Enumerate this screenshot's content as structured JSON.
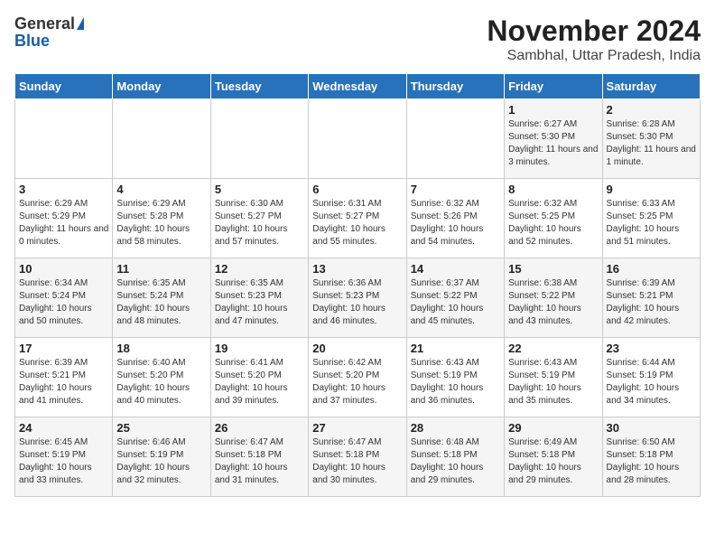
{
  "header": {
    "logo_general": "General",
    "logo_blue": "Blue",
    "title": "November 2024",
    "subtitle": "Sambhal, Uttar Pradesh, India"
  },
  "days_of_week": [
    "Sunday",
    "Monday",
    "Tuesday",
    "Wednesday",
    "Thursday",
    "Friday",
    "Saturday"
  ],
  "weeks": [
    [
      {
        "day": "",
        "info": ""
      },
      {
        "day": "",
        "info": ""
      },
      {
        "day": "",
        "info": ""
      },
      {
        "day": "",
        "info": ""
      },
      {
        "day": "",
        "info": ""
      },
      {
        "day": "1",
        "info": "Sunrise: 6:27 AM\nSunset: 5:30 PM\nDaylight: 11 hours and 3 minutes."
      },
      {
        "day": "2",
        "info": "Sunrise: 6:28 AM\nSunset: 5:30 PM\nDaylight: 11 hours and 1 minute."
      }
    ],
    [
      {
        "day": "3",
        "info": "Sunrise: 6:29 AM\nSunset: 5:29 PM\nDaylight: 11 hours and 0 minutes."
      },
      {
        "day": "4",
        "info": "Sunrise: 6:29 AM\nSunset: 5:28 PM\nDaylight: 10 hours and 58 minutes."
      },
      {
        "day": "5",
        "info": "Sunrise: 6:30 AM\nSunset: 5:27 PM\nDaylight: 10 hours and 57 minutes."
      },
      {
        "day": "6",
        "info": "Sunrise: 6:31 AM\nSunset: 5:27 PM\nDaylight: 10 hours and 55 minutes."
      },
      {
        "day": "7",
        "info": "Sunrise: 6:32 AM\nSunset: 5:26 PM\nDaylight: 10 hours and 54 minutes."
      },
      {
        "day": "8",
        "info": "Sunrise: 6:32 AM\nSunset: 5:25 PM\nDaylight: 10 hours and 52 minutes."
      },
      {
        "day": "9",
        "info": "Sunrise: 6:33 AM\nSunset: 5:25 PM\nDaylight: 10 hours and 51 minutes."
      }
    ],
    [
      {
        "day": "10",
        "info": "Sunrise: 6:34 AM\nSunset: 5:24 PM\nDaylight: 10 hours and 50 minutes."
      },
      {
        "day": "11",
        "info": "Sunrise: 6:35 AM\nSunset: 5:24 PM\nDaylight: 10 hours and 48 minutes."
      },
      {
        "day": "12",
        "info": "Sunrise: 6:35 AM\nSunset: 5:23 PM\nDaylight: 10 hours and 47 minutes."
      },
      {
        "day": "13",
        "info": "Sunrise: 6:36 AM\nSunset: 5:23 PM\nDaylight: 10 hours and 46 minutes."
      },
      {
        "day": "14",
        "info": "Sunrise: 6:37 AM\nSunset: 5:22 PM\nDaylight: 10 hours and 45 minutes."
      },
      {
        "day": "15",
        "info": "Sunrise: 6:38 AM\nSunset: 5:22 PM\nDaylight: 10 hours and 43 minutes."
      },
      {
        "day": "16",
        "info": "Sunrise: 6:39 AM\nSunset: 5:21 PM\nDaylight: 10 hours and 42 minutes."
      }
    ],
    [
      {
        "day": "17",
        "info": "Sunrise: 6:39 AM\nSunset: 5:21 PM\nDaylight: 10 hours and 41 minutes."
      },
      {
        "day": "18",
        "info": "Sunrise: 6:40 AM\nSunset: 5:20 PM\nDaylight: 10 hours and 40 minutes."
      },
      {
        "day": "19",
        "info": "Sunrise: 6:41 AM\nSunset: 5:20 PM\nDaylight: 10 hours and 39 minutes."
      },
      {
        "day": "20",
        "info": "Sunrise: 6:42 AM\nSunset: 5:20 PM\nDaylight: 10 hours and 37 minutes."
      },
      {
        "day": "21",
        "info": "Sunrise: 6:43 AM\nSunset: 5:19 PM\nDaylight: 10 hours and 36 minutes."
      },
      {
        "day": "22",
        "info": "Sunrise: 6:43 AM\nSunset: 5:19 PM\nDaylight: 10 hours and 35 minutes."
      },
      {
        "day": "23",
        "info": "Sunrise: 6:44 AM\nSunset: 5:19 PM\nDaylight: 10 hours and 34 minutes."
      }
    ],
    [
      {
        "day": "24",
        "info": "Sunrise: 6:45 AM\nSunset: 5:19 PM\nDaylight: 10 hours and 33 minutes."
      },
      {
        "day": "25",
        "info": "Sunrise: 6:46 AM\nSunset: 5:19 PM\nDaylight: 10 hours and 32 minutes."
      },
      {
        "day": "26",
        "info": "Sunrise: 6:47 AM\nSunset: 5:18 PM\nDaylight: 10 hours and 31 minutes."
      },
      {
        "day": "27",
        "info": "Sunrise: 6:47 AM\nSunset: 5:18 PM\nDaylight: 10 hours and 30 minutes."
      },
      {
        "day": "28",
        "info": "Sunrise: 6:48 AM\nSunset: 5:18 PM\nDaylight: 10 hours and 29 minutes."
      },
      {
        "day": "29",
        "info": "Sunrise: 6:49 AM\nSunset: 5:18 PM\nDaylight: 10 hours and 29 minutes."
      },
      {
        "day": "30",
        "info": "Sunrise: 6:50 AM\nSunset: 5:18 PM\nDaylight: 10 hours and 28 minutes."
      }
    ]
  ]
}
